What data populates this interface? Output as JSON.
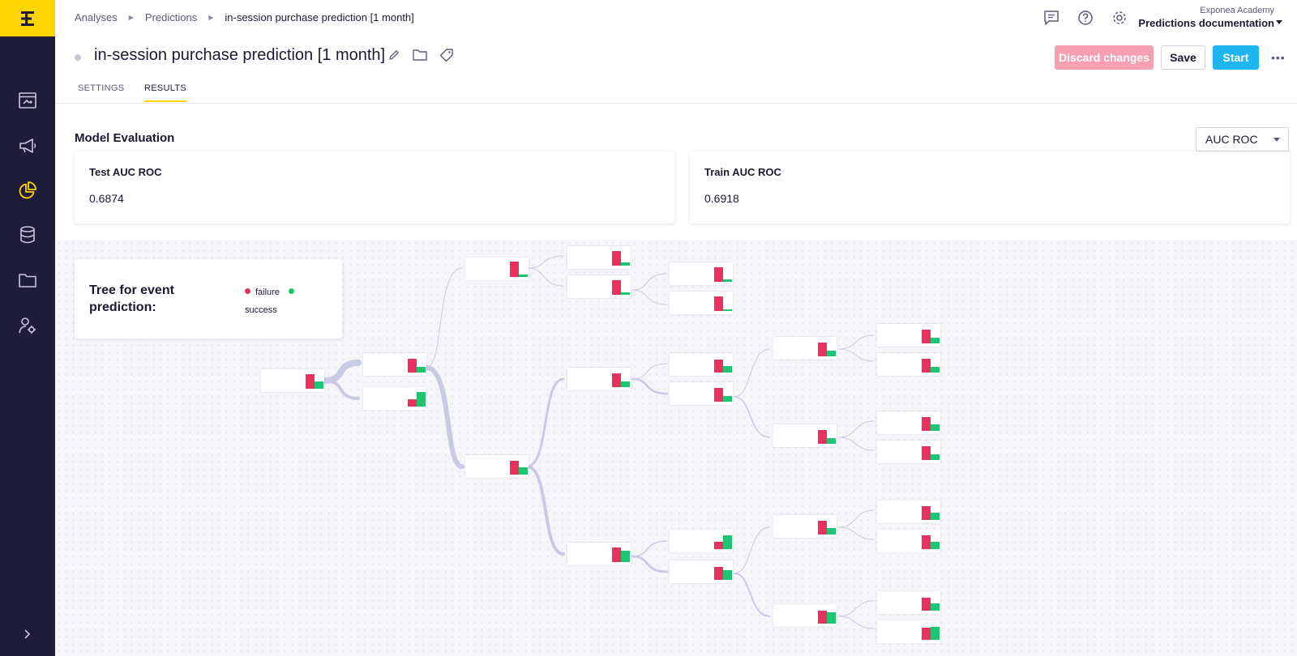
{
  "sidebar": {
    "logo": "E",
    "items": [
      {
        "name": "dashboard-icon"
      },
      {
        "name": "campaigns-icon"
      },
      {
        "name": "analyses-icon"
      },
      {
        "name": "data-icon"
      },
      {
        "name": "assets-icon"
      },
      {
        "name": "customer-icon"
      }
    ],
    "expand_icon": "chevron-right-icon",
    "active_color": "#ffd500"
  },
  "breadcrumb": {
    "items": [
      "Analyses",
      "Predictions"
    ],
    "current": "in-session purchase prediction [1 month]"
  },
  "account": {
    "org": "Exponea Academy",
    "project": "Predictions documentation"
  },
  "header": {
    "title": "in-session purchase prediction [1 month]",
    "discard_label": "Discard changes",
    "save_label": "Save",
    "start_label": "Start",
    "more_label": "•••"
  },
  "tabs": [
    {
      "label": "SETTINGS",
      "active": false
    },
    {
      "label": "RESULTS",
      "active": true
    }
  ],
  "evaluation": {
    "title": "Model Evaluation",
    "metric_selected": "AUC ROC",
    "test_label": "Test AUC ROC",
    "test_value": "0.6874",
    "train_label": "Train AUC ROC",
    "train_value": "0.6918"
  },
  "tree_legend": {
    "title": "Tree for event prediction:",
    "failure_label": "failure",
    "success_label": "success",
    "failure_color": "#e8315c",
    "success_color": "#1ec46f"
  }
}
